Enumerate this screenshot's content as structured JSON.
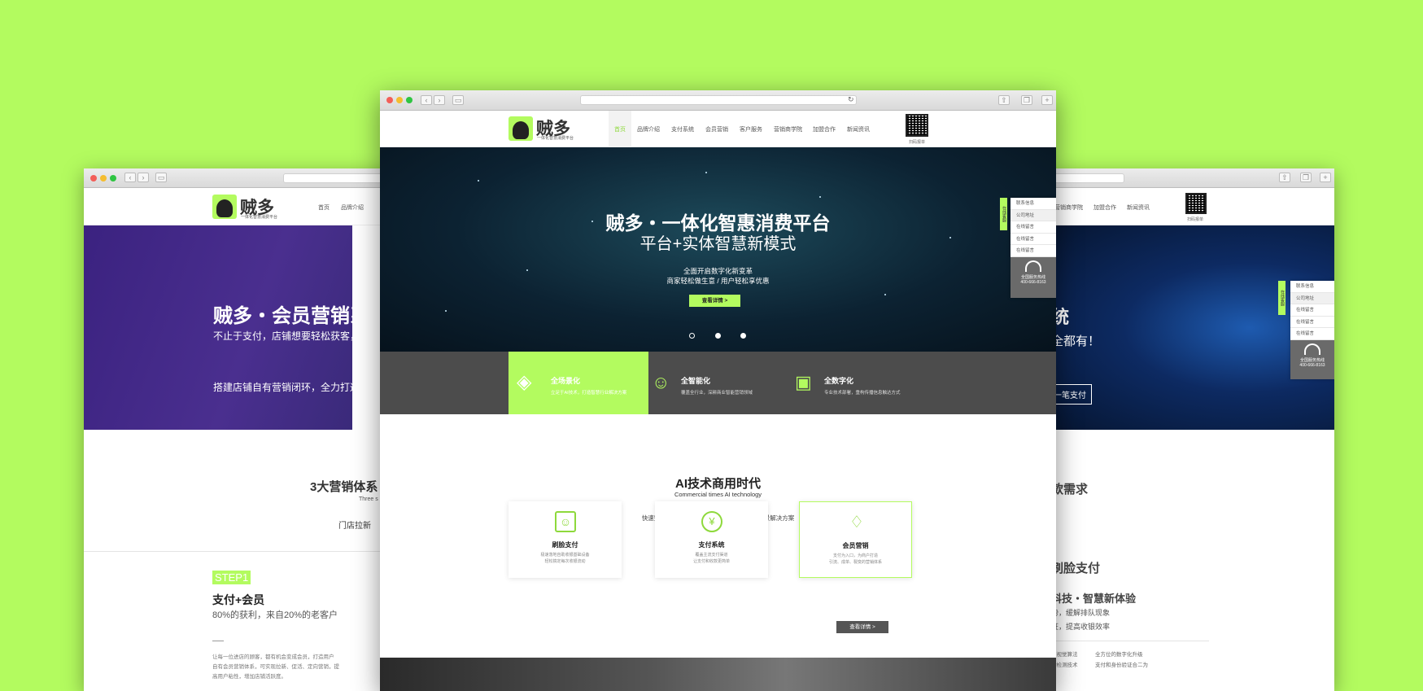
{
  "brand": {
    "name": "贼多",
    "tagline": "一体化智慧消费平台",
    "qr_caption": "扫码报单"
  },
  "nav": [
    "首页",
    "品牌介绍",
    "支付系统",
    "会员营销",
    "客户服务",
    "营销商学院",
    "加盟合作",
    "新闻资讯"
  ],
  "left_window": {
    "nav": [
      "首页",
      "品牌介绍"
    ],
    "hero_title": "贼多・会员营销系",
    "hero_sub": "不止于支付，店铺想要轻松获客，从现",
    "hero_line": "搭建店铺自有营销闭环，全力打通门店流",
    "section_title": "3大营销体系",
    "section_en": "Three s",
    "tab": "门店拉新",
    "step": "STEP1",
    "step_title": "支付+会员",
    "step_sub": "80%的获利，来自20%的老客户",
    "step_body": [
      "让每一位进店的顾客，都有机会变成会员，打造用户",
      "自有会员营销体系，可实现拉新、促活、定向营销，提",
      "高用户粘性，增加店铺活跃度。"
    ]
  },
  "right_window": {
    "nav": [
      "营销商学院",
      "加盟合作",
      "新闻资讯"
    ],
    "hero_title": "统",
    "hero_sub": "全都有！",
    "hero_btn": "一笔支付",
    "section_title": "款需求",
    "item_title": "刷脸支付",
    "item_sub": "科技・智慧新体验",
    "item_lines": [
      "势，缓解排队现象",
      "证，提高收银效率"
    ],
    "bullets": [
      "度视觉算法",
      "动检测技术",
      "全方位的数字化升级",
      "支付和身份验证合二为"
    ],
    "side": {
      "tab": "在线客服",
      "items": [
        "联系信息",
        "公司地址",
        "在线留言",
        "在线留言",
        "在线留言"
      ],
      "hot_label": "全国服务热线",
      "hot_phone": "400-666-8163"
    }
  },
  "hero": {
    "title": "贼多・一体化智惠消费平台",
    "subtitle": "平台+实体智慧新模式",
    "line1": "全面开启数字化新变革",
    "line2": "商家轻松做生意 / 用户轻松享优惠",
    "button": "查看详情 >"
  },
  "features": [
    {
      "title": "全场景化",
      "desc": "立足于AI技术，打造智慧行业解决方案"
    },
    {
      "title": "全智能化",
      "desc": "覆盖全行业，深耕商业智能营销领域"
    },
    {
      "title": "全数字化",
      "desc": "专业技术部署，重构传播信息触达方式"
    }
  ],
  "section": {
    "title": "AI技术商用时代",
    "en": "Commercial times AI technology",
    "desc": "快速完成智能收银系统搭建，打造智慧行业场景解决方案"
  },
  "cards": [
    {
      "title": "刷脸支付",
      "line1": "极速落地自助收银基础设备",
      "line2": "轻松搞定每次收银流动"
    },
    {
      "title": "支付系统",
      "line1": "覆盖主流支付渠道",
      "line2": "让支付和收款更简单"
    },
    {
      "title": "会员营销",
      "line1": "支付为入口，为商户打造",
      "line2": "引流、成单、裂变的营销体系",
      "button": "查看详情 >"
    }
  ],
  "side_panel": {
    "tab": "在线客服",
    "items": [
      "联系信息",
      "公司地址",
      "在线留言",
      "在线留言",
      "在线留言"
    ],
    "hot_label": "全国服务热线",
    "hot_phone": "400-666-8163"
  },
  "colors": {
    "accent": "#b3fb5f",
    "dark": "#4c4c4c",
    "purple": "#3b2280"
  }
}
